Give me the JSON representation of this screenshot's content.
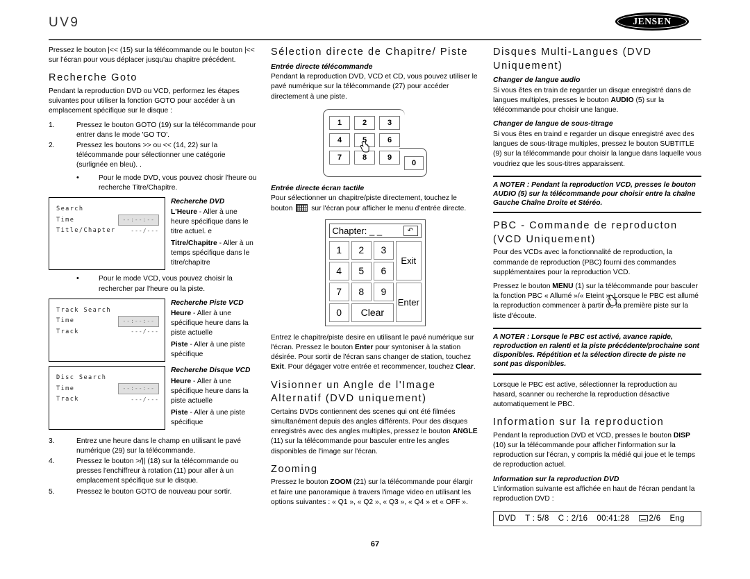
{
  "header": {
    "model": "UV9",
    "logo_text": "JENSEN",
    "logo_tm": "®"
  },
  "footer": {
    "page_number": "67"
  },
  "left_column": {
    "intro": "Pressez le bouton |<< (15) sur la télécommande ou le bouton |<< sur l'écran pour vous déplacer jusqu'au chapitre précédent.",
    "heading_goto": "Recherche Goto",
    "goto_intro": "Pendant la reproduction DVD ou VCD, performez les étapes suivantes pour utiliser la fonction GOTO pour accéder à un emplacement spécifique sur le disque :",
    "steps": [
      {
        "num": "1.",
        "text": "Pressez le bouton GOTO (19) sur la télécommande pour entrer dans le mode 'GO TO'."
      },
      {
        "num": "2.",
        "text": "Pressez les boutons >> ou << (14, 22) sur la télécommande pour sélectionner une catégorie (surlignée en bleu). ."
      }
    ],
    "bullet_dvd": "Pour le mode DVD, vous pouvez chosir l'heure ou recherche Titre/Chapitre.",
    "bullet_vcd": "Pour le mode VCD, vous pouvez choisir la rechercher par l'heure ou la piste.",
    "search_box": {
      "title": "Search",
      "row1_label": "Time",
      "row1_value": "--:--:--",
      "row2_label": "Title/Chapter",
      "row2_value": "---/---"
    },
    "search_note": {
      "heading": "Recherche DVD",
      "item1_term": "L'Heure",
      "item1_text": " - Aller à une heure spécifique dans le titre actuel. e",
      "item2_term": "Titre/Chapitre",
      "item2_text": " - Aller à un temps spécifique dans le titre/chapitre"
    },
    "track_box": {
      "title": "Track Search",
      "row1_label": "Time",
      "row1_value": "--:--:--",
      "row2_label": "Track",
      "row2_value": "---/---"
    },
    "track_note": {
      "heading": "Recherche Piste VCD",
      "item1_term": "Heure",
      "item1_text": " - Aller à une spécifique heure dans la piste actuelle",
      "item2_term": "Piste",
      "item2_text": " - Aller à une piste spécifique"
    },
    "disc_box": {
      "title": "Disc Search",
      "row1_label": "Time",
      "row1_value": "--:--:--",
      "row2_label": "Track",
      "row2_value": "---/---"
    },
    "disc_note": {
      "heading": "Recherche Disque VCD",
      "item1_term": "Heure",
      "item1_text": " - Aller à une spécifique heure dans la piste actuelle",
      "item2_term": "Piste",
      "item2_text": " - Aller à une piste spécifique"
    },
    "steps_tail": [
      {
        "num": "3.",
        "text": "Entrez une heure dans le champ en utilisant le pavé numérique (29) sur la télécommande."
      },
      {
        "num": "4.",
        "text": "Pressez le bouton >/|| (18) sur la télécommande ou presses l'enchiffreur à rotation (11) pour aller à un emplacement spécifique sur le disque."
      },
      {
        "num": "5.",
        "text": "Pressez le bouton GOTO de nouveau pour sortir."
      }
    ]
  },
  "middle_column": {
    "heading_direct": "Sélection directe de Chapitre/ Piste",
    "sub_remote": "Entrée directe télécommande",
    "remote_text": "Pendant la reproduction DVD, VCD et CD, vous pouvez utiliser le pavé numérique sur la télécommande (27) pour accéder directement à une piste.",
    "remote_keys": [
      "1",
      "2",
      "3",
      "4",
      "5",
      "6",
      "7",
      "8",
      "9"
    ],
    "remote_key_zero": "0",
    "sub_touch": "Entrée directe écran tactile",
    "touch_text_before": "Pour sélectionner un chapitre/piste directement, touchez le bouton ",
    "touch_text_after": " sur l'écran pour afficher le menu d'entrée directe.",
    "chapter_dialog": {
      "title_label": "Chapter: _ _",
      "back_icon": "back-arrow",
      "keys": [
        "1",
        "2",
        "3",
        "4",
        "5",
        "6",
        "7",
        "8",
        "9",
        "0"
      ],
      "clear_label": "Clear",
      "exit_label": "Exit",
      "enter_label": "Enter"
    },
    "dialog_text": "Entrez le chapitre/piste desire en utilisant le pavé numérique sur l'écran. Pressez le bouton Enter pour syntoniser à la station désirée. Pour sortir de l'écran sans changer de station, touchez Exit. Pour dégager votre entrée et recommencer, touchez Clear.",
    "heading_angle": "Visionner un Angle de l'Image Alternatif (DVD uniquement)",
    "angle_text": "Certains DVDs contiennent des scenes qui ont été filmées simultanément depuis des angles différents. Pour des disques enregistrés avec des angles multiples, pressez le bouton ANGLE (11) sur la télécommande pour basculer entre les angles disponibles de l'image sur l'écran.",
    "heading_zoom": "Zooming",
    "zoom_text": "Pressez le bouton ZOOM (21) sur la télécommande pour élargir et faire une panoramique à travers l'image video en utilisant les options suivantes : « Q1 », « Q2 », « Q3 », « Q4 » et « OFF »."
  },
  "right_column": {
    "heading_multilang": "Disques Multi-Langues (DVD Uniquement)",
    "sub_audio": "Changer de langue audio",
    "audio_text": "Si vous êtes en train de regarder un disque enregistré dans de langues multiples, presses le bouton AUDIO (5) sur la télécommande pour choisir une langue.",
    "sub_subtitle": "Changer de langue de sous-titrage",
    "subtitle_text": "Si vous êtes en traind e regarder un disque enregistré avec des langues de sous-titrage multiples, pressez le bouton SUBTITLE (9) sur la télécommande pour choisir la langue dans laquelle vous voudriez que les sous-titres apparaissent.",
    "notice_1": "A NOTER : Pendant la reproduction VCD, presses le bouton AUDIO (5) sur la télécommande pour choisir entre la chaîne Gauche Chaîne Droite et Stéréo.",
    "heading_pbc": "PBC - Commande de reproducton (VCD Uniquement)",
    "pbc_text_1": "Pour des VCDs avec la fonctionnalité de reproduction, la commande de reproduction (PBC) fourni des commandes supplémentaires pour la reproduction VCD.",
    "pbc_text_2": "Pressez le bouton MENU (1) sur la télécommande pour basculer la fonction PBC « Allumé »/« Eteint ». Lorsque le PBC est allumé la reproduction commencer à partir de la première piste sur la liste d'écoute.",
    "notice_2": "A NOTER : Lorsque le PBC est activé, avance rapide, reproduction en ralenti et la piste précédente/prochaine sont disponibles. Répétition et la sélection directe de piste ne sont pas disponibles.",
    "pbc_text_3": "Lorsque le PBC est active, sélectionner la reproduction au hasard, scanner ou recherche la reproduction désactive automatiquement le PBC.",
    "heading_info": "Information sur la reproduction",
    "info_text_1": "Pendant la reproduction DVD et VCD, presses le bouton DISP (10) sur la télécommande pour afficher l'information sur la reproduction sur l'écran, y compris la médié qui joue et le temps de reproduction actuel.",
    "sub_info_dvd": "Information sur la reproduction DVD",
    "info_text_2": "L'information suivante est affichée en haut de l'écran pendant la reproduction DVD :",
    "status_bar": {
      "media": "DVD",
      "title": "T : 5/8",
      "chapter": "C : 2/16",
      "time": "00:41:28",
      "subtitle_count": "2/6",
      "language": "Eng"
    }
  }
}
